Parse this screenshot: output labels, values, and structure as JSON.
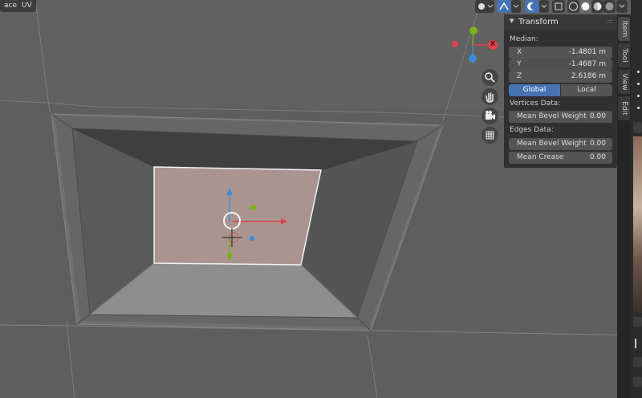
{
  "header": {
    "left_buttons": [
      "ace",
      "UV"
    ]
  },
  "panel": {
    "title": "Transform",
    "median_label": "Median:",
    "x": {
      "label": "X",
      "value": "-1.4801 m"
    },
    "y": {
      "label": "Y",
      "value": "-1.4687 m"
    },
    "z": {
      "label": "Z",
      "value": "2.6186 m"
    },
    "global_label": "Global",
    "local_label": "Local",
    "vertices_label": "Vertices Data:",
    "vertex_bevel": {
      "label": "Mean Bevel Weight",
      "value": "0.00"
    },
    "edges_label": "Edges Data:",
    "edge_bevel": {
      "label": "Mean Bevel Weight",
      "value": "0.00"
    },
    "edge_crease": {
      "label": "Mean Crease",
      "value": "0.00"
    }
  },
  "tabs": [
    "Item",
    "Tool",
    "View",
    "Edit"
  ],
  "gizmo": {
    "axis_x_label": "X"
  },
  "colors": {
    "accent": "#4772b3",
    "axis_x": "#e0414e",
    "axis_y": "#7ab317",
    "axis_z": "#3d8bd8",
    "selected_face": "#a99490"
  },
  "icons": [
    "zoom-icon",
    "pan-hand-icon",
    "camera-icon",
    "grid-icon",
    "mouse-select-icon",
    "gizmo-toggle-icon",
    "overlay-icon",
    "shading-wireframe-icon",
    "shading-solid-icon",
    "shading-material-icon",
    "shading-rendered-icon"
  ]
}
